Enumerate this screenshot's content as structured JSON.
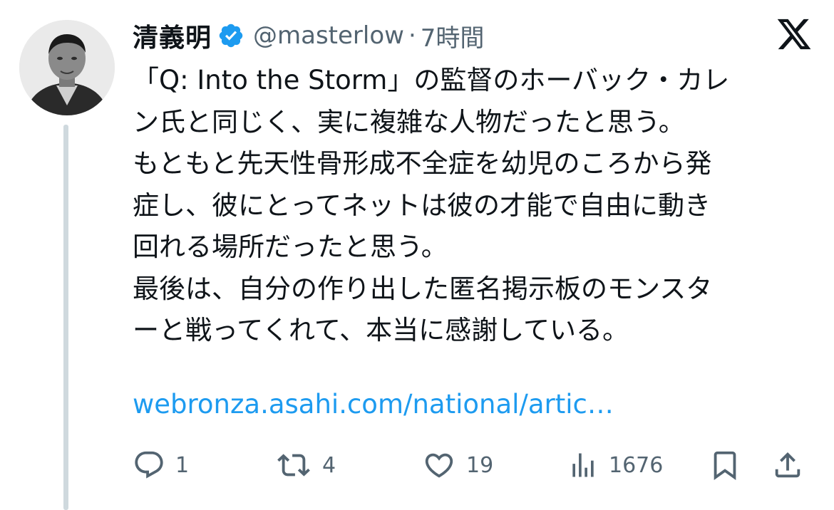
{
  "author": {
    "display_name": "清義明",
    "handle": "@masterlow",
    "separator": "·",
    "time": "7時間"
  },
  "tweet": {
    "lines": [
      "「Q: Into the Storm」の監督のホーバック・カレ",
      "ン氏と同じく、実に複雑な人物だったと思う。",
      "もともと先天性骨形成不全症を幼児のころから発",
      "症し、彼にとってネットは彼の才能で自由に動き",
      "回れる場所だったと思う。",
      "最後は、自分の作り出した匿名掲示板のモンスタ",
      "ーと戦ってくれて、本当に感謝している。"
    ],
    "link_text": "webronza.asahi.com/national/artic…"
  },
  "actions": {
    "reply_count": "1",
    "retweet_count": "4",
    "like_count": "19",
    "views_count": "1676"
  },
  "icons": {
    "verified": "verified-badge-icon",
    "logo": "x-logo-icon",
    "reply": "reply-icon",
    "retweet": "retweet-icon",
    "like": "heart-icon",
    "views": "views-bar-chart-icon",
    "bookmark": "bookmark-icon",
    "share": "share-icon"
  },
  "colors": {
    "text": "#0f1419",
    "secondary": "#536471",
    "link": "#1d9bf0",
    "verified": "#1d9bf0",
    "thread_line": "#cfd9de"
  }
}
